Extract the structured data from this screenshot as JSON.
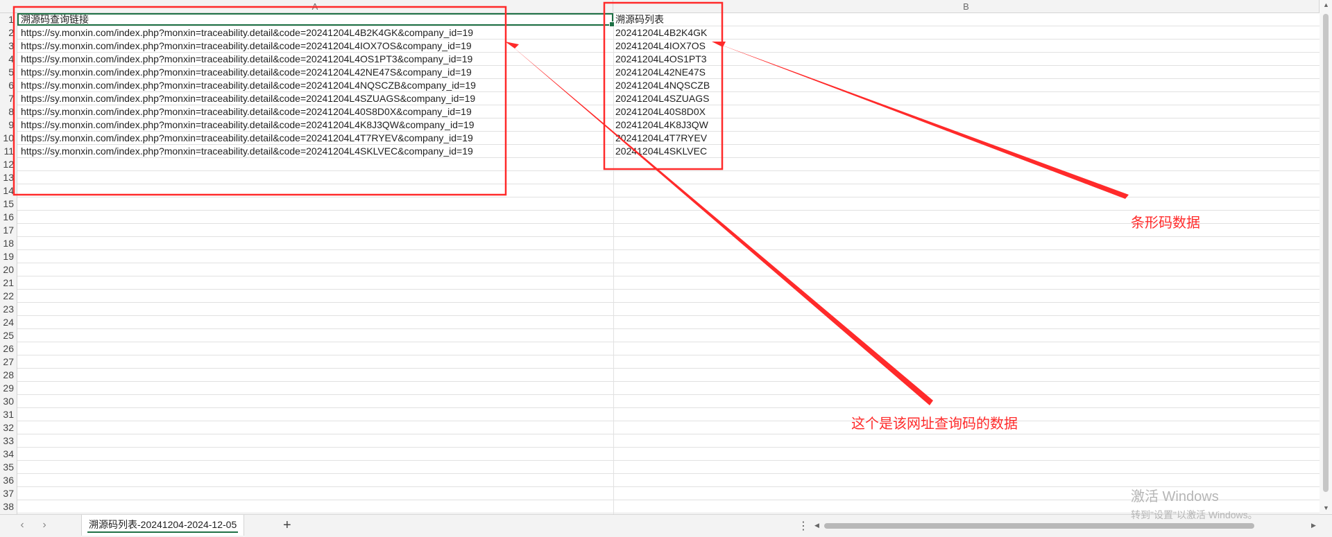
{
  "columns": [
    "A",
    "B"
  ],
  "rows": [
    "1",
    "2",
    "3",
    "4",
    "5",
    "6",
    "7",
    "8",
    "9",
    "10",
    "11",
    "12",
    "13",
    "14",
    "15",
    "16",
    "17",
    "18",
    "19",
    "20",
    "21",
    "22",
    "23",
    "24",
    "25",
    "26",
    "27",
    "28",
    "29",
    "30",
    "31",
    "32",
    "33",
    "34",
    "35",
    "36",
    "37",
    "38"
  ],
  "cells": [
    {
      "a": "溯源码查询链接",
      "b": "溯源码列表"
    },
    {
      "a": "https://sy.monxin.com/index.php?monxin=traceability.detail&code=20241204L4B2K4GK&company_id=19",
      "b": "20241204L4B2K4GK"
    },
    {
      "a": "https://sy.monxin.com/index.php?monxin=traceability.detail&code=20241204L4IOX7OS&company_id=19",
      "b": "20241204L4IOX7OS"
    },
    {
      "a": "https://sy.monxin.com/index.php?monxin=traceability.detail&code=20241204L4OS1PT3&company_id=19",
      "b": "20241204L4OS1PT3"
    },
    {
      "a": "https://sy.monxin.com/index.php?monxin=traceability.detail&code=20241204L42NE47S&company_id=19",
      "b": "20241204L42NE47S"
    },
    {
      "a": "https://sy.monxin.com/index.php?monxin=traceability.detail&code=20241204L4NQSCZB&company_id=19",
      "b": "20241204L4NQSCZB"
    },
    {
      "a": "https://sy.monxin.com/index.php?monxin=traceability.detail&code=20241204L4SZUAGS&company_id=19",
      "b": "20241204L4SZUAGS"
    },
    {
      "a": "https://sy.monxin.com/index.php?monxin=traceability.detail&code=20241204L40S8D0X&company_id=19",
      "b": "20241204L40S8D0X"
    },
    {
      "a": "https://sy.monxin.com/index.php?monxin=traceability.detail&code=20241204L4K8J3QW&company_id=19",
      "b": "20241204L4K8J3QW"
    },
    {
      "a": "https://sy.monxin.com/index.php?monxin=traceability.detail&code=20241204L4T7RYEV&company_id=19",
      "b": "20241204L4T7RYEV"
    },
    {
      "a": "https://sy.monxin.com/index.php?monxin=traceability.detail&code=20241204L4SKLVEC&company_id=19",
      "b": "20241204L4SKLVEC"
    }
  ],
  "sheet_tab": "溯源码列表-20241204-2024-12-05",
  "add_sheet": "+",
  "more": "⋮",
  "annotations": {
    "barcode_label": "条形码数据",
    "url_label": "这个是该网址查询码的数据"
  },
  "watermark": {
    "title": "激活 Windows",
    "subtitle": "转到\"设置\"以激活 Windows。"
  },
  "colors": {
    "annotation": "#ff2a2a",
    "active_cell": "#1e7145"
  }
}
